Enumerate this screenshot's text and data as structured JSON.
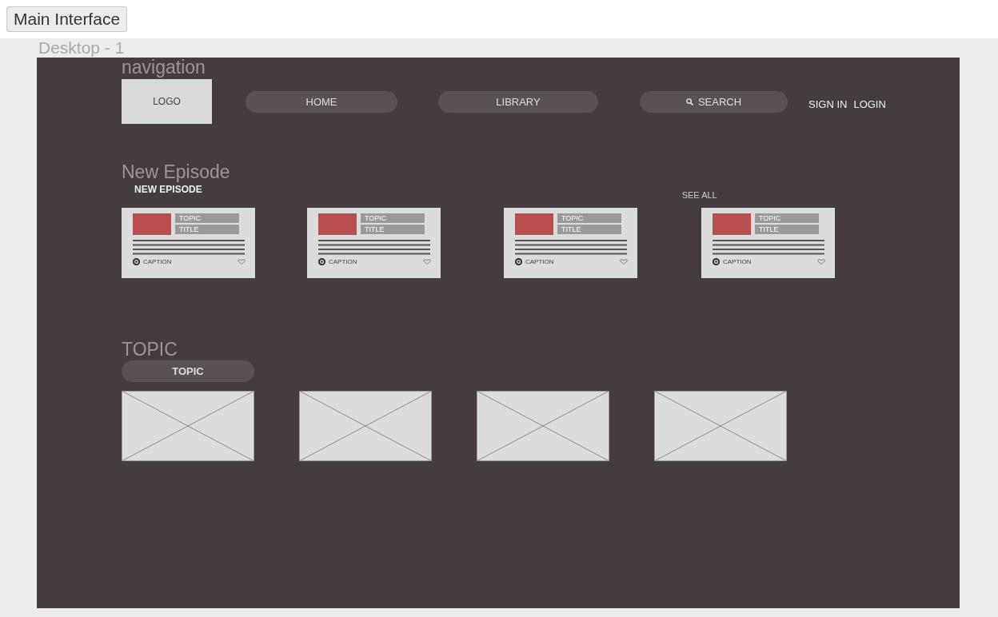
{
  "header_button": "Main Interface",
  "frame_title": "Desktop - 1",
  "navigation": {
    "heading": "navigation",
    "logo": "LOGO",
    "links": [
      {
        "label": "HOME",
        "kind": "plain"
      },
      {
        "label": "LIBRARY",
        "kind": "plain"
      },
      {
        "label": "SEARCH",
        "kind": "search"
      }
    ],
    "auth_links": [
      "SIGN IN",
      "LOGIN"
    ]
  },
  "new_episode": {
    "heading": "New Episode",
    "label": "NEW EPISODE",
    "see_all": "SEE ALL",
    "cards": [
      {
        "topic": "TOPIC",
        "title": "TITLE",
        "caption": "CAPTION"
      },
      {
        "topic": "TOPIC",
        "title": "TITLE",
        "caption": "CAPTION"
      },
      {
        "topic": "TOPIC",
        "title": "TITLE",
        "caption": "CAPTION"
      },
      {
        "topic": "TOPIC",
        "title": "TITLE",
        "caption": "CAPTION"
      }
    ]
  },
  "topic": {
    "heading": "TOPIC",
    "button": "TOPIC",
    "tiles": [
      {
        "kind": "image_placeholder"
      },
      {
        "kind": "image_placeholder"
      },
      {
        "kind": "image_placeholder"
      },
      {
        "kind": "image_placeholder"
      }
    ]
  }
}
